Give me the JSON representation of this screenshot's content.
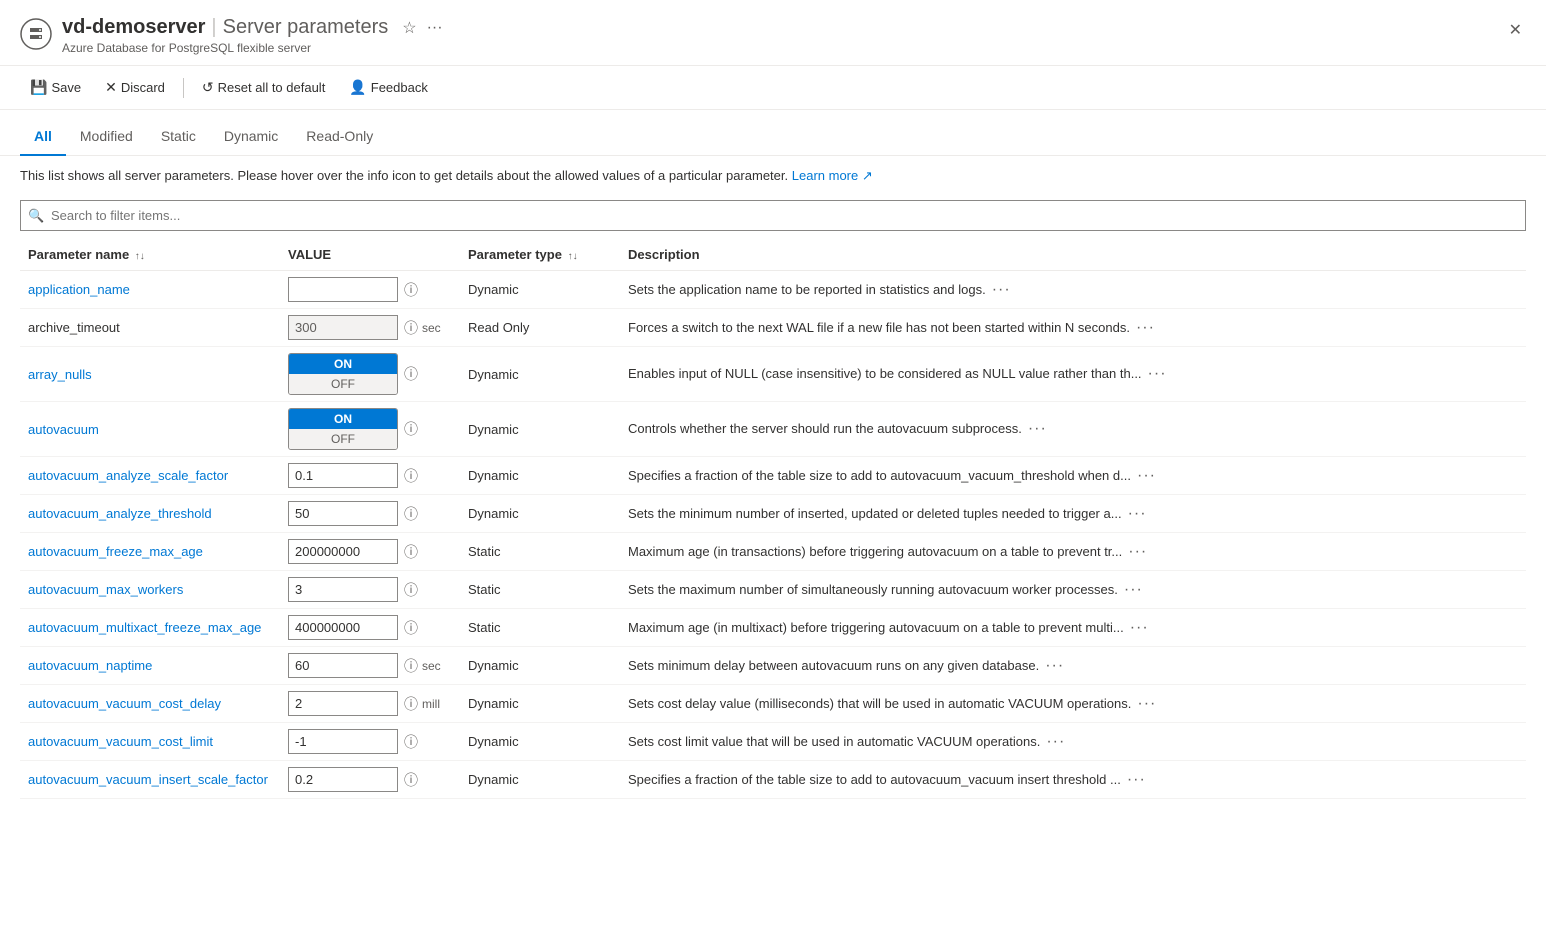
{
  "header": {
    "icon": "⚙",
    "server_name": "vd-demoserver",
    "separator": "|",
    "page_title": "Server parameters",
    "subtitle": "Azure Database for PostgreSQL flexible server",
    "star_icon": "☆",
    "more_icon": "···",
    "close_icon": "✕"
  },
  "toolbar": {
    "save_label": "Save",
    "discard_label": "Discard",
    "reset_label": "Reset all to default",
    "feedback_label": "Feedback"
  },
  "tabs": [
    {
      "id": "all",
      "label": "All",
      "active": true
    },
    {
      "id": "modified",
      "label": "Modified",
      "active": false
    },
    {
      "id": "static",
      "label": "Static",
      "active": false
    },
    {
      "id": "dynamic",
      "label": "Dynamic",
      "active": false
    },
    {
      "id": "readonly",
      "label": "Read-Only",
      "active": false
    }
  ],
  "info": {
    "text": "This list shows all server parameters. Please hover over the info icon to get details about the allowed values of a particular parameter.",
    "link_text": "Learn more",
    "link_icon": "↗"
  },
  "search": {
    "placeholder": "Search to filter items..."
  },
  "table": {
    "columns": [
      {
        "id": "name",
        "label": "Parameter name",
        "sortable": true
      },
      {
        "id": "value",
        "label": "VALUE",
        "sortable": false
      },
      {
        "id": "type",
        "label": "Parameter type",
        "sortable": true
      },
      {
        "id": "desc",
        "label": "Description",
        "sortable": false
      }
    ],
    "rows": [
      {
        "name": "application_name",
        "value": "",
        "value_type": "text",
        "unit": "",
        "param_type": "Dynamic",
        "description": "Sets the application name to be reported in statistics and logs.",
        "is_link": true
      },
      {
        "name": "archive_timeout",
        "value": "300",
        "value_type": "text",
        "unit": "sec",
        "param_type": "Read Only",
        "description": "Forces a switch to the next WAL file if a new file has not been started within N seconds.",
        "is_link": false,
        "readonly": true
      },
      {
        "name": "array_nulls",
        "value": "ON",
        "value_type": "toggle",
        "unit": "",
        "param_type": "Dynamic",
        "description": "Enables input of NULL (case insensitive) to be considered as NULL value rather than th...",
        "is_link": true
      },
      {
        "name": "autovacuum",
        "value": "ON",
        "value_type": "toggle",
        "unit": "",
        "param_type": "Dynamic",
        "description": "Controls whether the server should run the autovacuum subprocess.",
        "is_link": true
      },
      {
        "name": "autovacuum_analyze_scale_factor",
        "value": "0.1",
        "value_type": "text",
        "unit": "",
        "param_type": "Dynamic",
        "description": "Specifies a fraction of the table size to add to autovacuum_vacuum_threshold when d...",
        "is_link": true
      },
      {
        "name": "autovacuum_analyze_threshold",
        "value": "50",
        "value_type": "text",
        "unit": "",
        "param_type": "Dynamic",
        "description": "Sets the minimum number of inserted, updated or deleted tuples needed to trigger a...",
        "is_link": true
      },
      {
        "name": "autovacuum_freeze_max_age",
        "value": "200000000",
        "value_type": "text",
        "unit": "",
        "param_type": "Static",
        "description": "Maximum age (in transactions) before triggering autovacuum on a table to prevent tr...",
        "is_link": true
      },
      {
        "name": "autovacuum_max_workers",
        "value": "3",
        "value_type": "text",
        "unit": "",
        "param_type": "Static",
        "description": "Sets the maximum number of simultaneously running autovacuum worker processes.",
        "is_link": true
      },
      {
        "name": "autovacuum_multixact_freeze_max_age",
        "value": "400000000",
        "value_type": "text",
        "unit": "",
        "param_type": "Static",
        "description": "Maximum age (in multixact) before triggering autovacuum on a table to prevent multi...",
        "is_link": true
      },
      {
        "name": "autovacuum_naptime",
        "value": "60",
        "value_type": "text",
        "unit": "sec",
        "param_type": "Dynamic",
        "description": "Sets minimum delay between autovacuum runs on any given database.",
        "is_link": true
      },
      {
        "name": "autovacuum_vacuum_cost_delay",
        "value": "2",
        "value_type": "text",
        "unit": "mill",
        "param_type": "Dynamic",
        "description": "Sets cost delay value (milliseconds) that will be used in automatic VACUUM operations.",
        "is_link": true
      },
      {
        "name": "autovacuum_vacuum_cost_limit",
        "value": "-1",
        "value_type": "text",
        "unit": "",
        "param_type": "Dynamic",
        "description": "Sets cost limit value that will be used in automatic VACUUM operations.",
        "is_link": true
      },
      {
        "name": "autovacuum_vacuum_insert_scale_factor",
        "value": "0.2",
        "value_type": "text",
        "unit": "",
        "param_type": "Dynamic",
        "description": "Specifies a fraction of the table size to add to autovacuum_vacuum insert threshold ...",
        "is_link": true
      }
    ]
  }
}
